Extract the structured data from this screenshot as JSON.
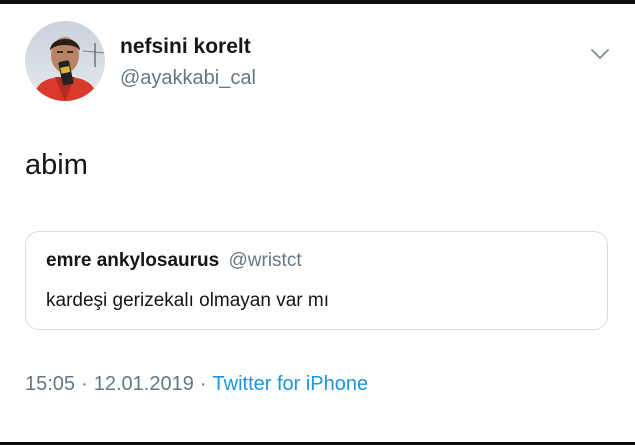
{
  "tweet": {
    "author_name": "nefsini korelt",
    "author_handle": "@ayakkabi_cal",
    "text": "abim",
    "time": "15:05",
    "separator": "·",
    "date": "12.01.2019",
    "source": "Twitter for iPhone"
  },
  "quoted_tweet": {
    "author_name": "emre ankylosaurus",
    "author_handle": "@wristct",
    "text": "kardeşi gerizekalı olmayan var mı"
  },
  "icons": {
    "menu": "chevron-down-icon"
  },
  "colors": {
    "primary_text": "#14171a",
    "secondary_text": "#657786",
    "link": "#1b95e0",
    "border": "#d3dbe2"
  }
}
